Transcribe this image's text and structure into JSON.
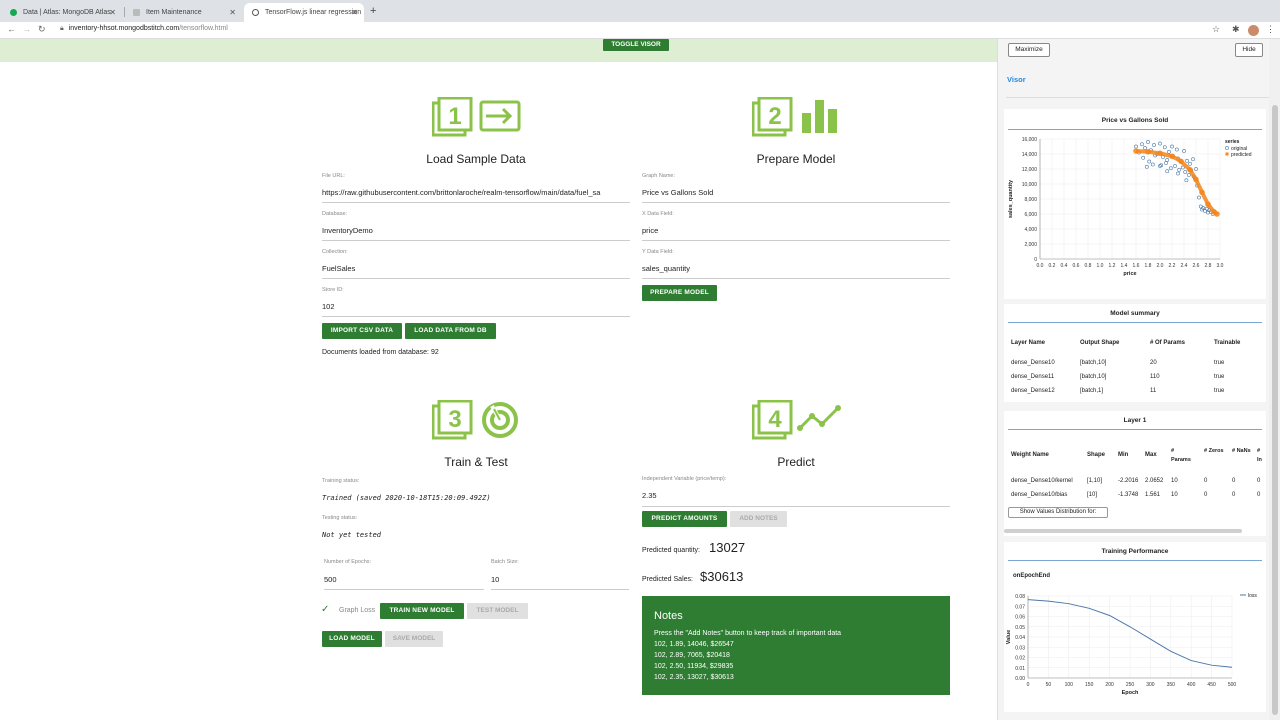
{
  "browser": {
    "tabs": [
      {
        "title": "Data | Atlas: MongoDB Atlas",
        "favicon_color": "#13aa52"
      },
      {
        "title": "Item Maintenance",
        "favicon_color": "#999999"
      },
      {
        "title": "TensorFlow.js linear regression",
        "favicon_color": "#555555"
      }
    ],
    "url_host": "inventory-hhsot.mongodbstitch.com",
    "url_path": "/tensorflow.html"
  },
  "header": {
    "toggle_visor": "TOGGLE VISOR"
  },
  "step1": {
    "number": "1",
    "title": "Load Sample Data",
    "file_url_label": "File URL:",
    "file_url": "https://raw.githubusercontent.com/brittonlaroche/realm-tensorflow/main/data/fuel_sa",
    "database_label": "Database:",
    "database": "InventoryDemo",
    "collection_label": "Collection:",
    "collection": "FuelSales",
    "store_label": "Store ID:",
    "store": "102",
    "import_btn": "IMPORT CSV DATA",
    "load_db_btn": "LOAD DATA FROM DB",
    "status": "Documents loaded from database: 92"
  },
  "step2": {
    "number": "2",
    "title": "Prepare Model",
    "graph_label": "Graph Name:",
    "graph": "Price vs Gallons Sold",
    "x_label": "X Data Field:",
    "x": "price",
    "y_label": "Y Data Field:",
    "y": "sales_quantity",
    "prepare_btn": "PREPARE MODEL"
  },
  "step3": {
    "number": "3",
    "title": "Train & Test",
    "training_label": "Training status:",
    "training": "Trained (saved 2020-10-18T15:20:09.492Z)",
    "testing_label": "Testing status:",
    "testing": "Not yet tested",
    "epochs_label": "Number of Epochs:",
    "epochs": "500",
    "batch_label": "Batch Size:",
    "batch": "10",
    "graph_loss": "Graph Loss",
    "train_btn": "TRAIN NEW MODEL",
    "test_btn": "TEST MODEL",
    "load_btn": "LOAD MODEL",
    "save_btn": "SAVE MODEL"
  },
  "step4": {
    "number": "4",
    "title": "Predict",
    "indep_label": "Independent Variable (price/temp):",
    "indep": "2.35",
    "predict_btn": "PREDICT AMOUNTS",
    "notes_btn": "ADD NOTES",
    "qty_label": "Predicted quantity:",
    "qty": "13027",
    "sales_label": "Predicted Sales:",
    "sales": "$30613"
  },
  "notes": {
    "heading": "Notes",
    "lines": [
      "Press the \"Add Notes\" button to keep track of important data",
      "102, 1.89, 14046, $26547",
      "102, 2.89, 7065, $20418",
      "102, 2.50, 11934, $29835",
      "102, 2.35, 13027, $30613"
    ]
  },
  "visor": {
    "maximize": "Maximize",
    "hide": "Hide",
    "tab": "Visor",
    "scatter_title": "Price vs Gallons Sold",
    "model_title": "Model summary",
    "model_headers": [
      "Layer Name",
      "Output Shape",
      "# Of Params",
      "Trainable"
    ],
    "model_rows": [
      [
        "dense_Dense10",
        "[batch,10]",
        "20",
        "true"
      ],
      [
        "dense_Dense11",
        "[batch,10]",
        "110",
        "true"
      ],
      [
        "dense_Dense12",
        "[batch,1]",
        "11",
        "true"
      ]
    ],
    "layer_title": "Layer 1",
    "layer_headers": [
      "Weight Name",
      "Shape",
      "Min",
      "Max",
      "# Params",
      "# Zeros",
      "# NaNs",
      "# In"
    ],
    "layer_rows": [
      [
        "dense_Dense10/kernel",
        "[1,10]",
        "-2.2016",
        "2.0652",
        "10",
        "0",
        "0",
        "0"
      ],
      [
        "dense_Dense10/bias",
        "[10]",
        "-1.3748",
        "1.561",
        "10",
        "0",
        "0",
        "0"
      ]
    ],
    "show_dist": "Show Values Distribution for:",
    "training_title": "Training Performance",
    "on_epoch": "onEpochEnd"
  },
  "chart_data": [
    {
      "type": "scatter",
      "title": "Price vs Gallons Sold",
      "xlabel": "price",
      "ylabel": "sales_quantity",
      "xlim": [
        0,
        3.0
      ],
      "ylim": [
        0,
        16000
      ],
      "x_ticks": [
        "0.0",
        "0.2",
        "0.4",
        "0.6",
        "0.8",
        "1.0",
        "1.2",
        "1.4",
        "1.6",
        "1.8",
        "2.0",
        "2.2",
        "2.4",
        "2.6",
        "2.8",
        "3.0"
      ],
      "y_ticks": [
        "0",
        "2,000",
        "4,000",
        "6,000",
        "8,000",
        "10,000",
        "12,000",
        "14,000",
        "16,000"
      ],
      "legend_title": "series",
      "legend": [
        "original",
        "predicted"
      ],
      "series": [
        {
          "name": "original",
          "color": "#4c78a8",
          "points": [
            [
              1.6,
              15000
            ],
            [
              1.65,
              14200
            ],
            [
              1.7,
              15300
            ],
            [
              1.72,
              13500
            ],
            [
              1.75,
              14800
            ],
            [
              1.8,
              15600
            ],
            [
              1.82,
              13000
            ],
            [
              1.85,
              14500
            ],
            [
              1.88,
              12600
            ],
            [
              1.9,
              15200
            ],
            [
              1.92,
              13800
            ],
            [
              1.95,
              14000
            ],
            [
              2.0,
              15400
            ],
            [
              2.02,
              12500
            ],
            [
              2.05,
              13600
            ],
            [
              2.08,
              14900
            ],
            [
              2.1,
              12800
            ],
            [
              2.12,
              13200
            ],
            [
              2.15,
              14300
            ],
            [
              2.18,
              12100
            ],
            [
              2.2,
              15000
            ],
            [
              2.22,
              13700
            ],
            [
              2.25,
              12400
            ],
            [
              2.28,
              14600
            ],
            [
              2.3,
              13400
            ],
            [
              2.32,
              11900
            ],
            [
              2.35,
              13000
            ],
            [
              2.38,
              12200
            ],
            [
              2.4,
              14400
            ],
            [
              2.42,
              11600
            ],
            [
              2.45,
              13100
            ],
            [
              2.48,
              11200
            ],
            [
              2.5,
              12700
            ],
            [
              2.52,
              11800
            ],
            [
              2.55,
              13300
            ],
            [
              2.58,
              10800
            ],
            [
              2.6,
              12000
            ],
            [
              2.62,
              9800
            ],
            [
              2.65,
              8200
            ],
            [
              2.68,
              7000
            ],
            [
              2.7,
              6600
            ],
            [
              2.72,
              6800
            ],
            [
              2.75,
              6400
            ],
            [
              2.78,
              6700
            ],
            [
              2.8,
              6200
            ],
            [
              2.82,
              6500
            ],
            [
              2.85,
              6300
            ],
            [
              2.88,
              6000
            ],
            [
              1.78,
              12300
            ],
            [
              2.0,
              12400
            ],
            [
              2.12,
              11700
            ],
            [
              2.3,
              11400
            ],
            [
              2.44,
              10500
            ],
            [
              2.56,
              11000
            ]
          ]
        },
        {
          "name": "predicted",
          "color": "#f58518",
          "points": [
            [
              1.6,
              14400
            ],
            [
              1.8,
              14300
            ],
            [
              2.0,
              14100
            ],
            [
              2.2,
              13700
            ],
            [
              2.35,
              13027
            ],
            [
              2.5,
              11900
            ],
            [
              2.6,
              10600
            ],
            [
              2.7,
              8900
            ],
            [
              2.8,
              7300
            ],
            [
              2.9,
              6300
            ],
            [
              2.95,
              6000
            ]
          ]
        }
      ]
    },
    {
      "type": "line",
      "title": "onEpochEnd",
      "xlabel": "Epoch",
      "ylabel": "Value",
      "xlim": [
        0,
        500
      ],
      "ylim": [
        0,
        0.08
      ],
      "x_ticks": [
        "0",
        "50",
        "100",
        "150",
        "200",
        "250",
        "300",
        "350",
        "400",
        "450",
        "500"
      ],
      "y_ticks": [
        "0.00",
        "0.01",
        "0.02",
        "0.03",
        "0.04",
        "0.05",
        "0.06",
        "0.07",
        "0.08"
      ],
      "legend": [
        "loss"
      ],
      "series": [
        {
          "name": "loss",
          "color": "#4c78a8",
          "points": [
            [
              0,
              0.0765
            ],
            [
              50,
              0.075
            ],
            [
              100,
              0.0725
            ],
            [
              150,
              0.068
            ],
            [
              200,
              0.061
            ],
            [
              250,
              0.05
            ],
            [
              300,
              0.038
            ],
            [
              350,
              0.026
            ],
            [
              400,
              0.017
            ],
            [
              450,
              0.0125
            ],
            [
              500,
              0.0105
            ]
          ]
        }
      ]
    }
  ]
}
